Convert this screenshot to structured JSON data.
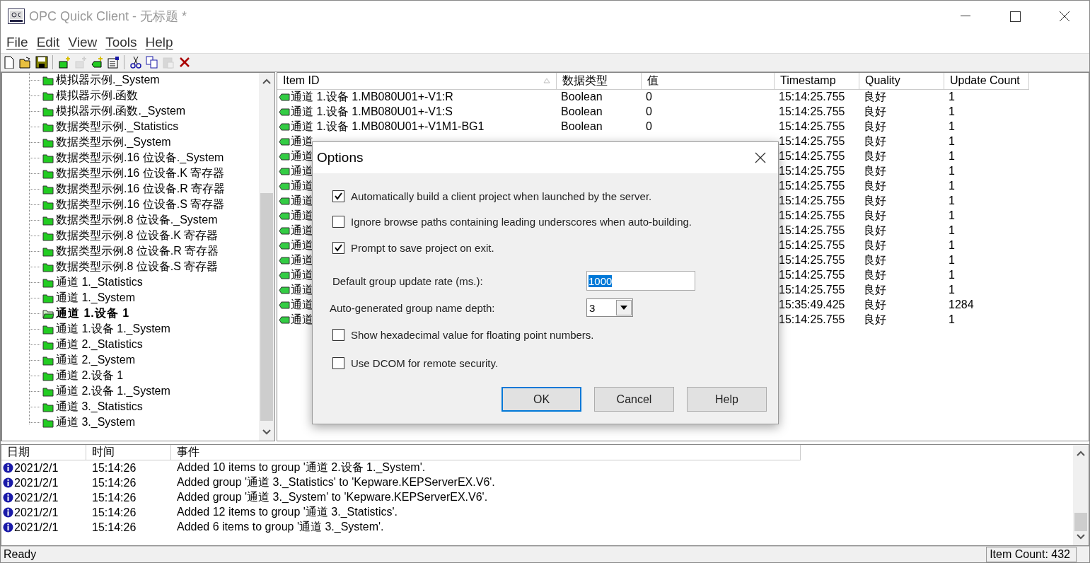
{
  "window": {
    "title": "OPC Quick Client - 无标题 *"
  },
  "menu": [
    "File",
    "Edit",
    "View",
    "Tools",
    "Help"
  ],
  "toolbar": [
    {
      "kind": "new",
      "disabled": false
    },
    {
      "kind": "open",
      "disabled": false
    },
    {
      "kind": "save",
      "disabled": false
    },
    {
      "kind": "sep"
    },
    {
      "kind": "newgroup",
      "disabled": false
    },
    {
      "kind": "newgroup",
      "disabled": true
    },
    {
      "kind": "newitem",
      "disabled": false
    },
    {
      "kind": "properties",
      "disabled": false
    },
    {
      "kind": "sep"
    },
    {
      "kind": "cut",
      "disabled": false
    },
    {
      "kind": "copy",
      "disabled": false
    },
    {
      "kind": "paste",
      "disabled": true
    },
    {
      "kind": "delete",
      "disabled": false
    }
  ],
  "tree": [
    {
      "label": "模拟器示例._System",
      "selected": false
    },
    {
      "label": "模拟器示例.函数",
      "selected": false
    },
    {
      "label": "模拟器示例.函数._System",
      "selected": false
    },
    {
      "label": "数据类型示例._Statistics",
      "selected": false
    },
    {
      "label": "数据类型示例._System",
      "selected": false
    },
    {
      "label": "数据类型示例.16 位设备._System",
      "selected": false
    },
    {
      "label": "数据类型示例.16 位设备.K 寄存器",
      "selected": false
    },
    {
      "label": "数据类型示例.16 位设备.R 寄存器",
      "selected": false
    },
    {
      "label": "数据类型示例.16 位设备.S 寄存器",
      "selected": false
    },
    {
      "label": "数据类型示例.8 位设备._System",
      "selected": false
    },
    {
      "label": "数据类型示例.8 位设备.K 寄存器",
      "selected": false
    },
    {
      "label": "数据类型示例.8 位设备.R 寄存器",
      "selected": false
    },
    {
      "label": "数据类型示例.8 位设备.S 寄存器",
      "selected": false
    },
    {
      "label": "通道 1._Statistics",
      "selected": false
    },
    {
      "label": "通道 1._System",
      "selected": false
    },
    {
      "label": "通道 1.设备 1",
      "selected": true
    },
    {
      "label": "通道 1.设备 1._System",
      "selected": false
    },
    {
      "label": "通道 2._Statistics",
      "selected": false
    },
    {
      "label": "通道 2._System",
      "selected": false
    },
    {
      "label": "通道 2.设备 1",
      "selected": false
    },
    {
      "label": "通道 2.设备 1._System",
      "selected": false
    },
    {
      "label": "通道 3._Statistics",
      "selected": false
    },
    {
      "label": "通道 3._System",
      "selected": false
    }
  ],
  "items": {
    "columns": [
      "Item ID",
      "数据类型",
      "值",
      "Timestamp",
      "Quality",
      "Update Count"
    ],
    "rows": [
      {
        "item_id": "通道 1.设备 1.MB080U01+-V1:R",
        "data_type": "Boolean",
        "value": "0",
        "timestamp": "15:14:25.755",
        "quality": "良好",
        "update_count": "1"
      },
      {
        "item_id": "通道 1.设备 1.MB080U01+-V1:S",
        "data_type": "Boolean",
        "value": "0",
        "timestamp": "15:14:25.755",
        "quality": "良好",
        "update_count": "1"
      },
      {
        "item_id": "通道 1.设备 1.MB080U01+-V1M1-BG1",
        "data_type": "Boolean",
        "value": "0",
        "timestamp": "15:14:25.755",
        "quality": "良好",
        "update_count": "1"
      },
      {
        "item_id": "通道",
        "timestamp": "15:14:25.755",
        "quality": "良好",
        "update_count": "1"
      },
      {
        "item_id": "通道",
        "timestamp": "15:14:25.755",
        "quality": "良好",
        "update_count": "1"
      },
      {
        "item_id": "通道",
        "timestamp": "15:14:25.755",
        "quality": "良好",
        "update_count": "1"
      },
      {
        "item_id": "通道",
        "timestamp": "15:14:25.755",
        "quality": "良好",
        "update_count": "1"
      },
      {
        "item_id": "通道",
        "timestamp": "15:14:25.755",
        "quality": "良好",
        "update_count": "1"
      },
      {
        "item_id": "通道",
        "timestamp": "15:14:25.755",
        "quality": "良好",
        "update_count": "1"
      },
      {
        "item_id": "通道",
        "timestamp": "15:14:25.755",
        "quality": "良好",
        "update_count": "1"
      },
      {
        "item_id": "通道",
        "timestamp": "15:14:25.755",
        "quality": "良好",
        "update_count": "1"
      },
      {
        "item_id": "通道",
        "timestamp": "15:14:25.755",
        "quality": "良好",
        "update_count": "1"
      },
      {
        "item_id": "通道",
        "timestamp": "15:14:25.755",
        "quality": "良好",
        "update_count": "1"
      },
      {
        "item_id": "通道",
        "timestamp": "15:14:25.755",
        "quality": "良好",
        "update_count": "1"
      },
      {
        "item_id": "通道",
        "timestamp": "15:35:49.425",
        "quality": "良好",
        "update_count": "1284"
      },
      {
        "item_id": "通道",
        "timestamp": "15:14:25.755",
        "quality": "良好",
        "update_count": "1"
      }
    ]
  },
  "dialog": {
    "title": "Options",
    "options": [
      {
        "kind": "check",
        "label": "Automatically build a client project when launched by the server.",
        "checked": true
      },
      {
        "kind": "check",
        "label": "Ignore browse paths containing leading underscores when auto-building.",
        "checked": false
      },
      {
        "kind": "check",
        "label": "Prompt to save project on exit.",
        "checked": true
      },
      {
        "kind": "input",
        "label": "Default group update rate (ms.):",
        "value": "1000"
      },
      {
        "kind": "select",
        "label": "Auto-generated group name depth:",
        "value": "3"
      },
      {
        "kind": "check",
        "label": "Show hexadecimal value for floating point numbers.",
        "checked": false
      },
      {
        "kind": "check",
        "label": "Use DCOM for remote security.",
        "checked": false
      }
    ],
    "buttons": [
      {
        "label": "OK",
        "default": true
      },
      {
        "label": "Cancel",
        "default": false
      },
      {
        "label": "Help",
        "default": false
      }
    ]
  },
  "log": {
    "columns": [
      "日期",
      "时间",
      "事件"
    ],
    "rows": [
      {
        "date": "2021/2/1",
        "time": "15:14:26",
        "event": "Added 10 items to group '通道 2.设备 1._System'."
      },
      {
        "date": "2021/2/1",
        "time": "15:14:26",
        "event": "Added group '通道 3._Statistics' to 'Kepware.KEPServerEX.V6'."
      },
      {
        "date": "2021/2/1",
        "time": "15:14:26",
        "event": "Added group '通道 3._System' to 'Kepware.KEPServerEX.V6'."
      },
      {
        "date": "2021/2/1",
        "time": "15:14:26",
        "event": "Added 12 items to group '通道 3._Statistics'."
      },
      {
        "date": "2021/2/1",
        "time": "15:14:26",
        "event": "Added 6 items to group '通道 3._System'."
      }
    ]
  },
  "status_bar": {
    "message": "Ready",
    "item_count": "Item Count: 432"
  }
}
